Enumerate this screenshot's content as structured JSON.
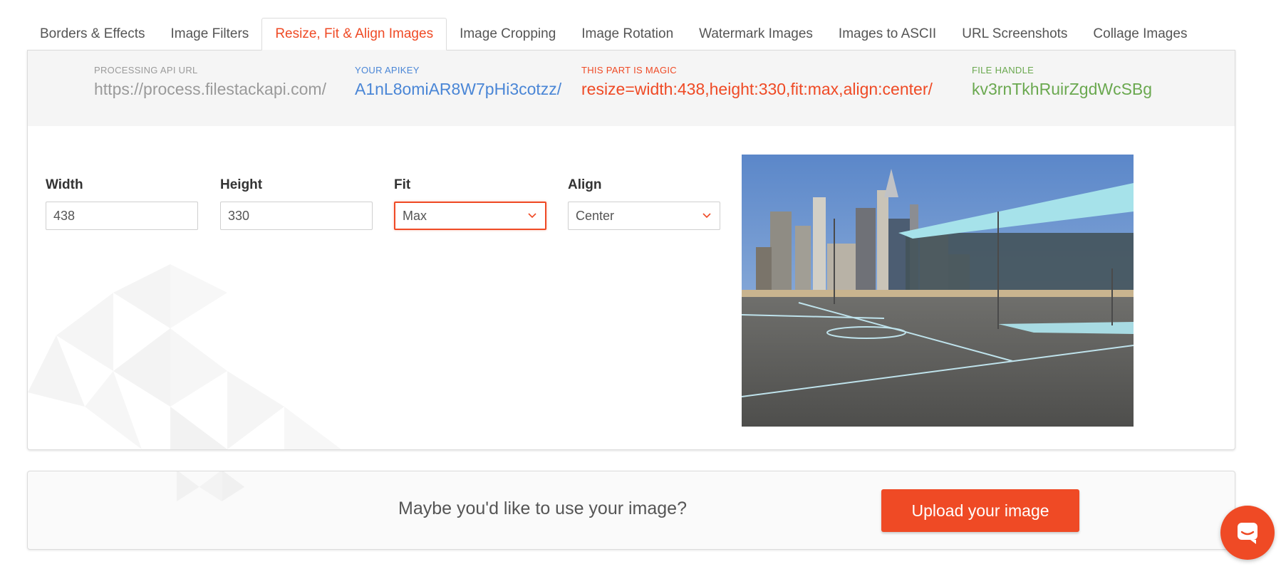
{
  "tabs": [
    {
      "label": "Borders & Effects",
      "active": false
    },
    {
      "label": "Image Filters",
      "active": false
    },
    {
      "label": "Resize, Fit & Align Images",
      "active": true
    },
    {
      "label": "Image Cropping",
      "active": false
    },
    {
      "label": "Image Rotation",
      "active": false
    },
    {
      "label": "Watermark Images",
      "active": false
    },
    {
      "label": "Images to ASCII",
      "active": false
    },
    {
      "label": "URL Screenshots",
      "active": false
    },
    {
      "label": "Collage Images",
      "active": false
    }
  ],
  "url": {
    "processing": {
      "label": "Processing API URL",
      "value": "https://process.filestackapi.com/"
    },
    "apikey": {
      "label": "Your APIKEY",
      "value": "A1nL8omiAR8W7pHi3cotzz/"
    },
    "magic": {
      "label": "This part is magic",
      "value": "resize=width:438,height:330,fit:max,align:center/"
    },
    "handle": {
      "label": "File handle",
      "value": "kv3rnTkhRuirZgdWcSBg"
    }
  },
  "form": {
    "width": {
      "label": "Width",
      "value": "438"
    },
    "height": {
      "label": "Height",
      "value": "330"
    },
    "fit": {
      "label": "Fit",
      "value": "Max"
    },
    "align": {
      "label": "Align",
      "value": "Center"
    }
  },
  "upload": {
    "message": "Maybe you'd like to use your image?",
    "button_label": "Upload your image"
  },
  "colors": {
    "accent": "#ef4a25",
    "apikey": "#4a86d6",
    "handle": "#6aa84f",
    "muted": "#9a9a9a"
  },
  "icons": {
    "dropdown": "chevron-down-icon",
    "chat": "chat-bubble-icon"
  }
}
